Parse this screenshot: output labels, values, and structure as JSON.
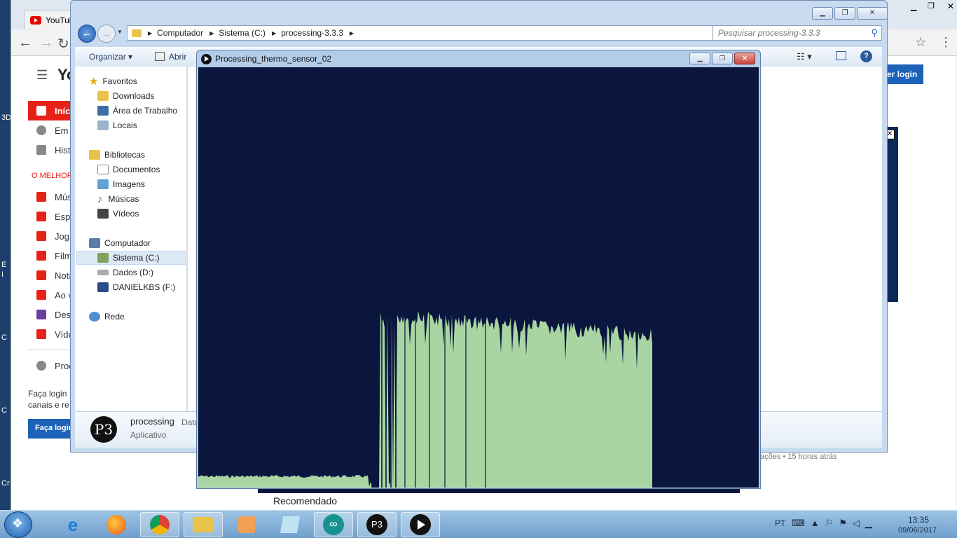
{
  "browser": {
    "tab_title": "YouTub",
    "yt_logo": "Yo",
    "login_button": "zer login",
    "login_button2": "Faça login",
    "best_of": "O MELHOR",
    "signin_text": "Faça login\ncanais e re",
    "sidebar": [
      {
        "label": "Iníci",
        "active": true
      },
      {
        "label": "Em"
      },
      {
        "label": "Hist"
      },
      {
        "label": "Mús"
      },
      {
        "label": "Espo"
      },
      {
        "label": "Jog"
      },
      {
        "label": "Film"
      },
      {
        "label": "Notí"
      },
      {
        "label": "Ao v"
      },
      {
        "label": "Des"
      },
      {
        "label": "Víde"
      },
      {
        "label": "Proc"
      }
    ],
    "views_text": "ações • 15 horas atrás",
    "recommended": "Recomendado",
    "desktop_chars": [
      "3D",
      "E",
      "I",
      "C",
      "C",
      "Cr"
    ]
  },
  "explorer": {
    "breadcrumb": [
      "Computador",
      "Sistema (C:)",
      "processing-3.3.3"
    ],
    "search_placeholder": "Pesquisar processing-3.3.3",
    "commands": {
      "organize": "Organizar",
      "open": "Abrir"
    },
    "nav": {
      "favorites": "Favoritos",
      "downloads": "Downloads",
      "desktop": "Área de Trabalho",
      "places": "Locais",
      "libraries": "Bibliotecas",
      "documents": "Documentos",
      "images": "Imagens",
      "music": "Músicas",
      "videos": "Vídeos",
      "computer": "Computador",
      "system_c": "Sistema (C:)",
      "data_d": "Dados (D:)",
      "usb_f": "DANIELKBS (F:)",
      "network": "Rede"
    },
    "details": {
      "name": "processing",
      "type": "Aplicativo",
      "date_label": "Data"
    }
  },
  "sketch": {
    "title": "Processing_thermo_sensor_02",
    "background_color": "#0a163e",
    "fill_color": "#a8d5a2"
  },
  "taskbar": {
    "language": "PT",
    "time": "13:35",
    "date": "09/06/2017"
  }
}
